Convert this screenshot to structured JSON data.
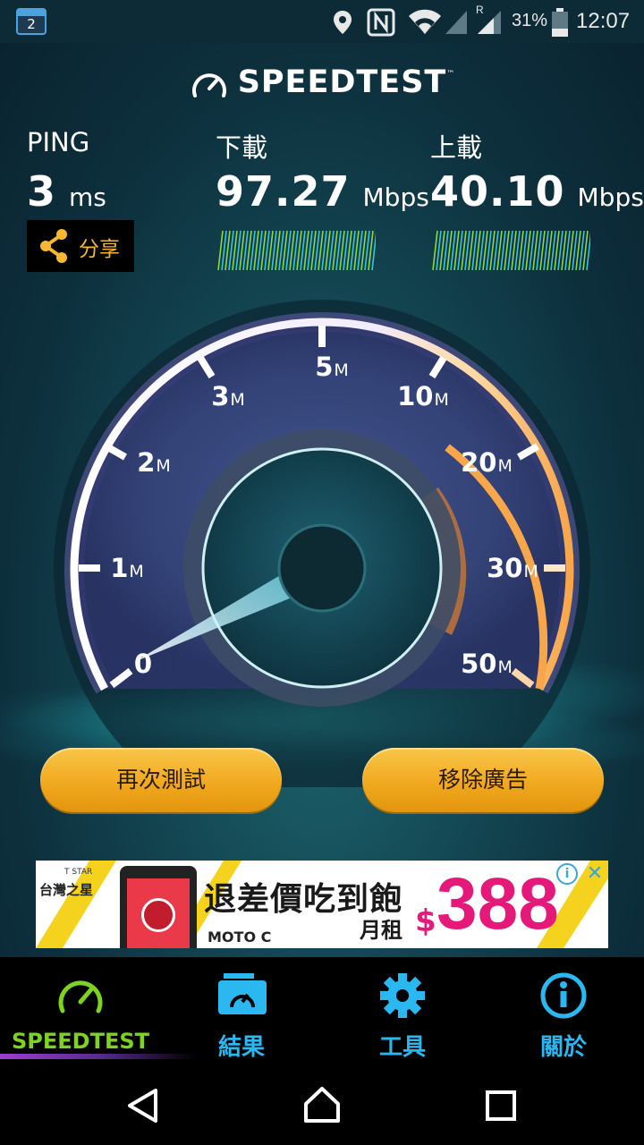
{
  "status_bar": {
    "calendar_day": "2",
    "battery_percent": "31%",
    "time": "12:07",
    "roaming_label": "R",
    "icons": [
      "calendar-icon",
      "location-icon",
      "nfc-icon",
      "wifi-icon",
      "signal-icon",
      "signal-roaming-icon",
      "battery-icon"
    ]
  },
  "header": {
    "app_name": "SPEEDTEST",
    "trademark": "™"
  },
  "metrics": {
    "ping": {
      "label": "PING",
      "value": "3",
      "unit": "ms"
    },
    "download": {
      "label": "下載",
      "value": "97.27",
      "unit": "Mbps"
    },
    "upload": {
      "label": "上載",
      "value": "40.10",
      "unit": "Mbps"
    }
  },
  "share": {
    "label": "分享"
  },
  "gauge": {
    "ticks": [
      {
        "num": "0",
        "unit": ""
      },
      {
        "num": "1",
        "unit": "M"
      },
      {
        "num": "2",
        "unit": "M"
      },
      {
        "num": "3",
        "unit": "M"
      },
      {
        "num": "5",
        "unit": "M"
      },
      {
        "num": "10",
        "unit": "M"
      },
      {
        "num": "20",
        "unit": "M"
      },
      {
        "num": "30",
        "unit": "M"
      },
      {
        "num": "50",
        "unit": "M"
      }
    ]
  },
  "buttons": {
    "test_again": "再次測試",
    "remove_ads": "移除廣告"
  },
  "ad": {
    "brand_small": "T STAR",
    "brand": "台灣之星",
    "headline": "退差價吃到飽",
    "phone_model": "MOTO C",
    "price_label": "月租",
    "currency": "$",
    "price": "388"
  },
  "bottom_nav": {
    "items": [
      {
        "label": "SPEEDTEST",
        "icon": "speedometer-icon",
        "active": true
      },
      {
        "label": "結果",
        "icon": "results-folder-icon"
      },
      {
        "label": "工具",
        "icon": "gear-icon"
      },
      {
        "label": "關於",
        "icon": "info-icon"
      }
    ]
  },
  "colors": {
    "accent_cyan": "#2bb8f0",
    "accent_green": "#7ed321",
    "button_gold": "#f1a91f",
    "share_orange": "#f7b731",
    "price_pink": "#e4197a"
  }
}
